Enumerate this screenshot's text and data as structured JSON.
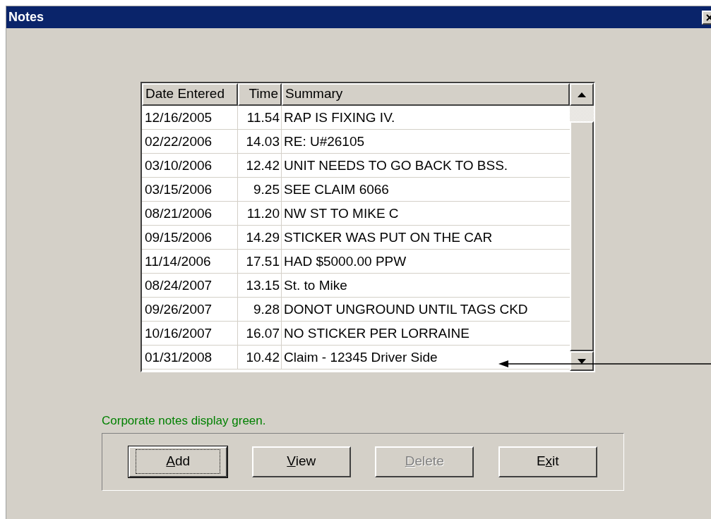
{
  "window": {
    "title": "Notes"
  },
  "table": {
    "columns": [
      "Date Entered",
      "Time",
      "Summary"
    ],
    "rows": [
      {
        "date": "12/16/2005",
        "time": "11.54",
        "summary": "RAP IS FIXING IV."
      },
      {
        "date": "02/22/2006",
        "time": "14.03",
        "summary": "RE:  U#26105"
      },
      {
        "date": "03/10/2006",
        "time": "12.42",
        "summary": "UNIT NEEDS TO GO BACK TO BSS."
      },
      {
        "date": "03/15/2006",
        "time": "9.25",
        "summary": "SEE CLAIM 6066"
      },
      {
        "date": "08/21/2006",
        "time": "11.20",
        "summary": "NW ST TO MIKE C"
      },
      {
        "date": "09/15/2006",
        "time": "14.29",
        "summary": "STICKER WAS PUT ON THE CAR"
      },
      {
        "date": "11/14/2006",
        "time": "17.51",
        "summary": "HAD $5000.00 PPW"
      },
      {
        "date": "08/24/2007",
        "time": "13.15",
        "summary": "St. to Mike"
      },
      {
        "date": "09/26/2007",
        "time": "9.28",
        "summary": "DONOT UNGROUND UNTIL TAGS CKD"
      },
      {
        "date": "10/16/2007",
        "time": "16.07",
        "summary": "NO STICKER PER LORRAINE"
      },
      {
        "date": "01/31/2008",
        "time": "10.42",
        "summary": "Claim - 12345 Driver Side"
      }
    ]
  },
  "legend": "Corporate notes display green.",
  "buttons": [
    {
      "label_parts": [
        {
          "text": "A",
          "underlined": true
        },
        {
          "text": "dd",
          "underlined": false
        }
      ],
      "default": true,
      "disabled": false
    },
    {
      "label_parts": [
        {
          "text": "V",
          "underlined": true
        },
        {
          "text": "iew",
          "underlined": false
        }
      ],
      "default": false,
      "disabled": false
    },
    {
      "label_parts": [
        {
          "text": "D",
          "underlined": true
        },
        {
          "text": "elete",
          "underlined": false
        }
      ],
      "default": false,
      "disabled": true
    },
    {
      "label_parts": [
        {
          "text": "E",
          "underlined": false
        },
        {
          "text": "x",
          "underlined": true
        },
        {
          "text": "it",
          "underlined": false
        }
      ],
      "default": false,
      "disabled": false
    }
  ]
}
